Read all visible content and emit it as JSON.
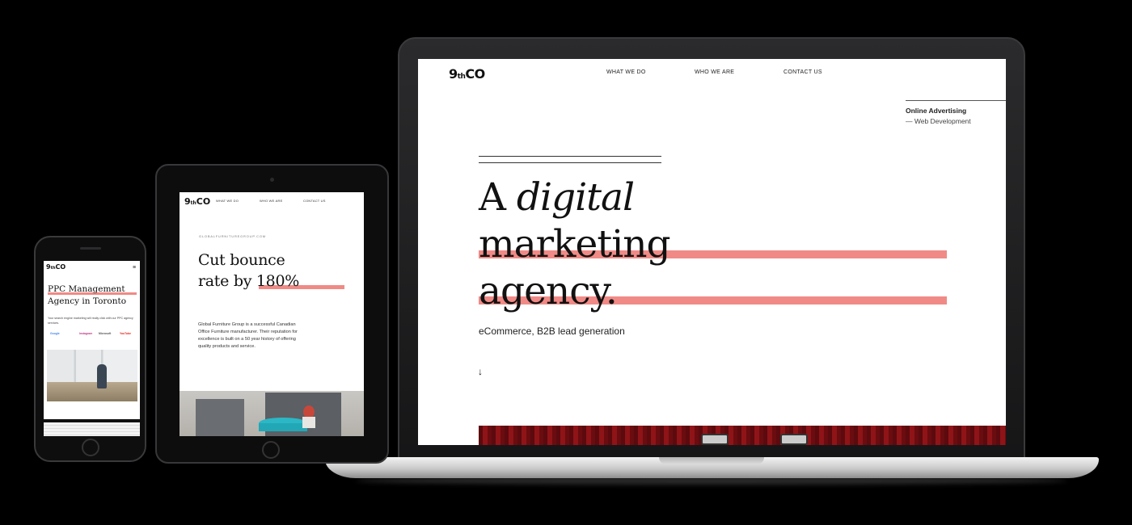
{
  "laptop": {
    "logo_main": "9",
    "logo_small": "th",
    "logo_end": "CO",
    "nav": [
      "WHAT WE DO",
      "WHO WE ARE",
      "CONTACT US"
    ],
    "side_title": "Online Advertising",
    "side_sub": "— Web Development",
    "headline_1a": "A ",
    "headline_1b": "digital",
    "headline_2": "marketing",
    "headline_3": "agency.",
    "subtitle": "eCommerce, B2B lead generation",
    "scroll_icon": "↓",
    "accent_color": "#f08a86"
  },
  "tablet": {
    "logo_main": "9",
    "logo_small": "th",
    "logo_end": "CO",
    "nav": [
      "WHAT WE DO",
      "WHO WE ARE",
      "CONTACT US"
    ],
    "url": "GLOBALFURNITUREGROUP.COM",
    "headline_1": "Cut bounce",
    "headline_2": "rate by 180%",
    "body": "Global Furniture Group is a successful Canadian Office Furniture manufacturer. Their reputation for excellence is built on a 50 year history of offering quality products and service."
  },
  "phone": {
    "logo_main": "9",
    "logo_small": "th",
    "logo_end": "CO",
    "menu_icon": "≡",
    "headline_1": "PPC Management",
    "headline_2": "Agency in Toronto",
    "body": "Your search engine marketing will really click with our PPC agency services.",
    "brands": [
      "Google",
      "Instagram",
      "Microsoft",
      "YouTube"
    ]
  }
}
